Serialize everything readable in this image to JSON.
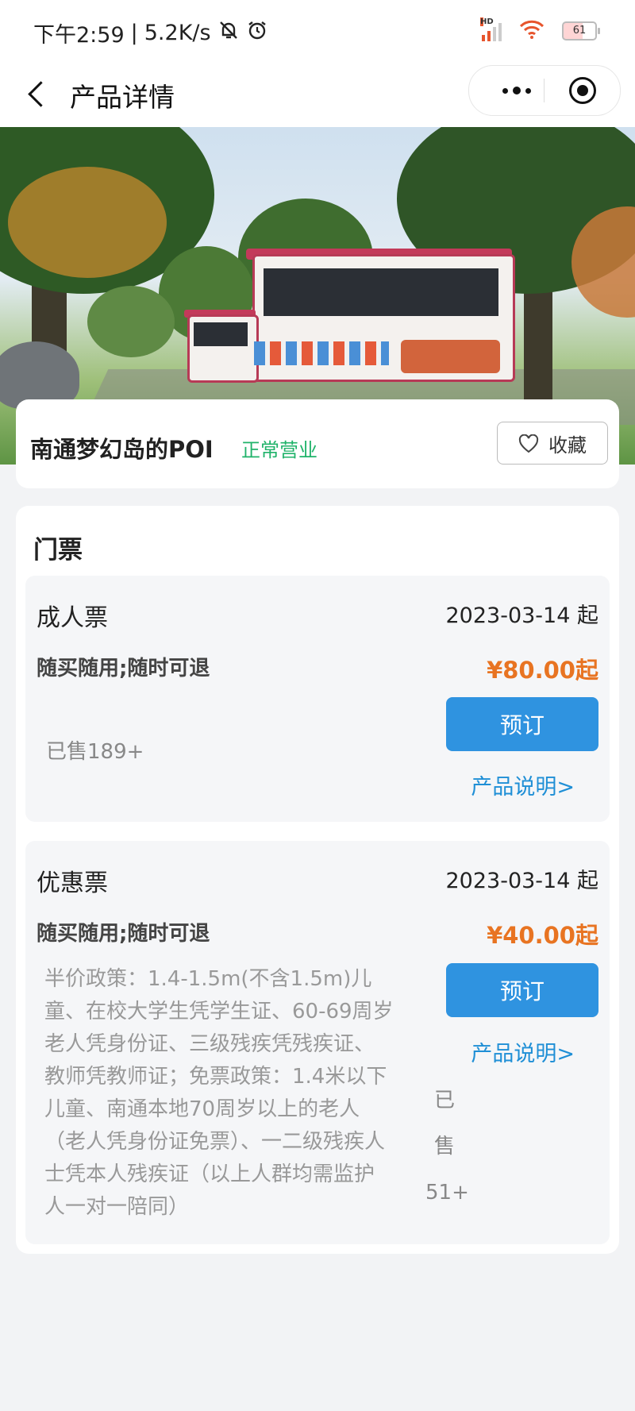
{
  "status_bar": {
    "time": "下午2:59",
    "separator": "|",
    "net_speed": "5.2K/s",
    "network_label": "HD",
    "battery": "61"
  },
  "nav": {
    "title": "产品详情"
  },
  "poi": {
    "name": "南通梦幻岛的POI",
    "status": "正常营业",
    "favorite_label": "收藏"
  },
  "tickets": {
    "section_title": "门票",
    "items": [
      {
        "name": "成人票",
        "date": "2023-03-14 起",
        "feature": "随买随用;随时可退",
        "price": "¥80.00起",
        "book_label": "预订",
        "info_link": "产品说明>",
        "sold": "已售189+"
      },
      {
        "name": "优惠票",
        "date": "2023-03-14 起",
        "feature": "随买随用;随时可退",
        "price": "¥40.00起",
        "book_label": "预订",
        "info_link": "产品说明>",
        "description": "半价政策：1.4-1.5m(不含1.5m)儿童、在校大学生凭学生证、60-69周岁老人凭身份证、三级残疾凭残疾证、教师凭教师证；免票政策：1.4米以下儿童、南通本地70周岁以上的老人（老人凭身份证免票）、一二级残疾人士凭本人残疾证（以上人群均需监护人一对一陪同）",
        "sold": "已售51+"
      }
    ]
  },
  "colors": {
    "accent_blue": "#2f93e0",
    "price_orange": "#e87422",
    "status_green": "#20b36a"
  }
}
